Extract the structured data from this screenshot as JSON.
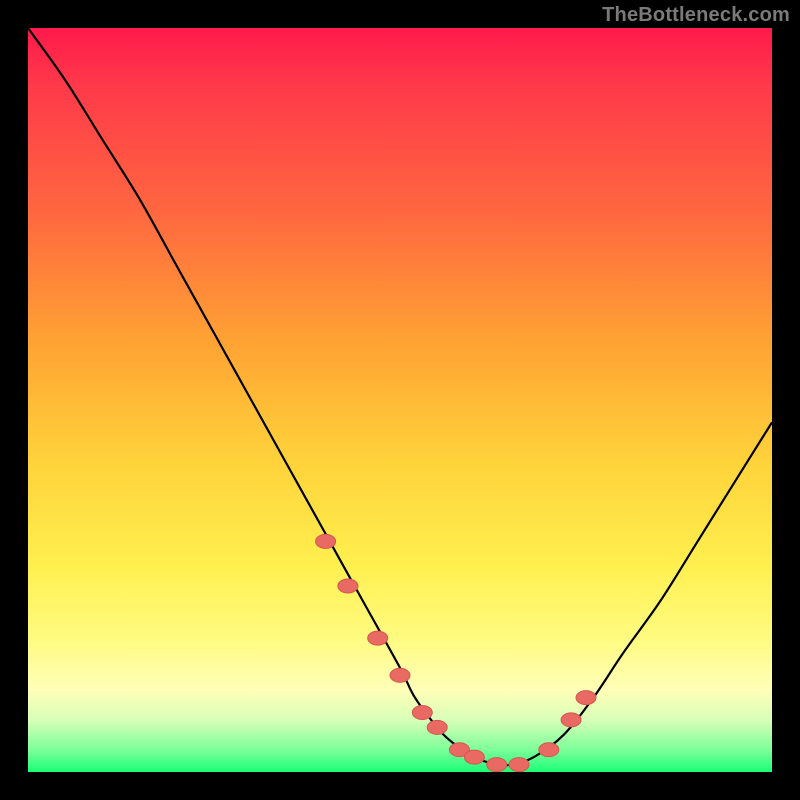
{
  "watermark": {
    "text": "TheBottleneck.com"
  },
  "colors": {
    "page_bg": "#000000",
    "curve_stroke": "#000000",
    "marker_fill": "#e86a62",
    "marker_stroke": "#d4564f"
  },
  "chart_data": {
    "type": "line",
    "title": "",
    "xlabel": "",
    "ylabel": "",
    "xlim": [
      0,
      100
    ],
    "ylim": [
      0,
      100
    ],
    "grid": false,
    "legend": false,
    "series": [
      {
        "name": "bottleneck-curve",
        "x": [
          0,
          5,
          10,
          15,
          20,
          25,
          30,
          35,
          40,
          45,
          50,
          52,
          55,
          57,
          60,
          63,
          65,
          68,
          72,
          76,
          80,
          85,
          90,
          95,
          100
        ],
        "values": [
          100,
          93,
          85,
          77,
          68,
          59,
          50,
          41,
          32,
          23,
          14,
          10,
          6,
          4,
          2,
          1,
          1,
          2,
          5,
          10,
          16,
          23,
          31,
          39,
          47
        ]
      }
    ],
    "markers": {
      "name": "highlighted-points",
      "x": [
        40,
        43,
        47,
        50,
        53,
        55,
        58,
        60,
        63,
        66,
        70,
        73,
        75
      ],
      "values": [
        31,
        25,
        18,
        13,
        8,
        6,
        3,
        2,
        1,
        1,
        3,
        7,
        10
      ]
    }
  }
}
